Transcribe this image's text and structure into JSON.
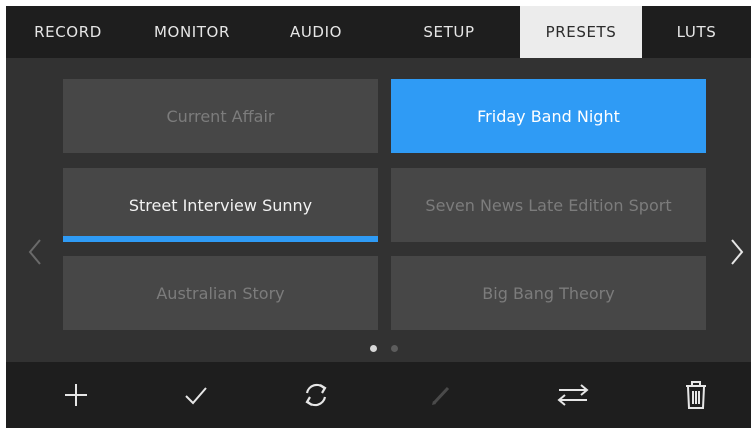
{
  "tabs": [
    {
      "label": "RECORD",
      "active": false
    },
    {
      "label": "MONITOR",
      "active": false
    },
    {
      "label": "AUDIO",
      "active": false
    },
    {
      "label": "SETUP",
      "active": false
    },
    {
      "label": "PRESETS",
      "active": true
    },
    {
      "label": "LUTS",
      "active": false
    }
  ],
  "presets": [
    {
      "name": "Current Affair",
      "state": "normal"
    },
    {
      "name": "Friday Band Night",
      "state": "selected"
    },
    {
      "name": "Street Interview Sunny",
      "state": "current"
    },
    {
      "name": "Seven News Late Edition Sport",
      "state": "normal"
    },
    {
      "name": "Australian Story",
      "state": "normal"
    },
    {
      "name": "Big Bang Theory",
      "state": "normal"
    }
  ],
  "pagination": {
    "current_page": 1,
    "total_pages": 2
  },
  "toolbar": {
    "icons": [
      "plus-icon",
      "check-icon",
      "refresh-icon",
      "pencil-icon",
      "swap-arrows-icon",
      "trash-icon"
    ],
    "disabled": [
      "pencil-icon"
    ]
  },
  "colors": {
    "accent": "#2f9bf5",
    "background": "#323232",
    "bar": "#1e1e1e",
    "button": "#474747",
    "active_tab": "#ececec"
  }
}
